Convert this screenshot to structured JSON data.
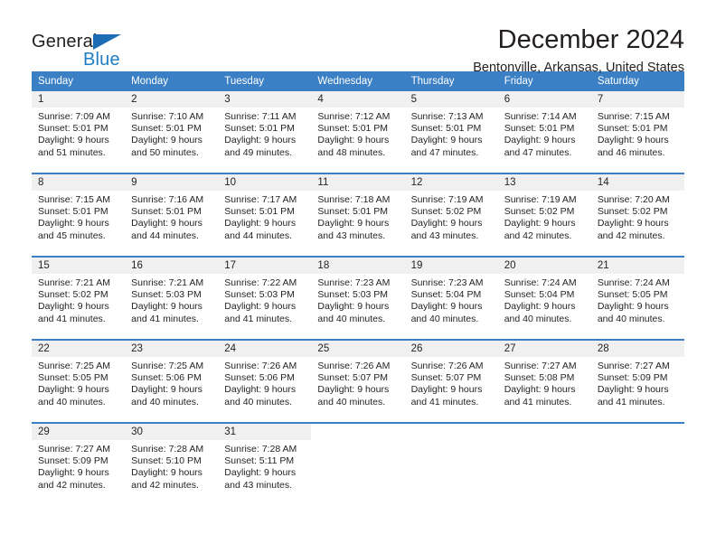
{
  "brand": {
    "name_part1": "General",
    "name_part2": "Blue",
    "triangle_color": "#1b6cb5",
    "blue_color": "#1f7ec4"
  },
  "header": {
    "month_title": "December 2024",
    "location": "Bentonville, Arkansas, United States"
  },
  "theme": {
    "header_bg": "#3b7fc4",
    "daynum_bg": "#f0f0f0",
    "rule_color": "#3b7fc4",
    "text_color": "#231f20"
  },
  "labels": {
    "sunrise_prefix": "Sunrise:",
    "sunset_prefix": "Sunset:",
    "daylight_prefix": "Daylight:"
  },
  "weekday_headers": [
    "Sunday",
    "Monday",
    "Tuesday",
    "Wednesday",
    "Thursday",
    "Friday",
    "Saturday"
  ],
  "weeks": [
    [
      {
        "day": "1",
        "sunrise": "Sunrise: 7:09 AM",
        "sunset": "Sunset: 5:01 PM",
        "daylight": "Daylight: 9 hours and 51 minutes."
      },
      {
        "day": "2",
        "sunrise": "Sunrise: 7:10 AM",
        "sunset": "Sunset: 5:01 PM",
        "daylight": "Daylight: 9 hours and 50 minutes."
      },
      {
        "day": "3",
        "sunrise": "Sunrise: 7:11 AM",
        "sunset": "Sunset: 5:01 PM",
        "daylight": "Daylight: 9 hours and 49 minutes."
      },
      {
        "day": "4",
        "sunrise": "Sunrise: 7:12 AM",
        "sunset": "Sunset: 5:01 PM",
        "daylight": "Daylight: 9 hours and 48 minutes."
      },
      {
        "day": "5",
        "sunrise": "Sunrise: 7:13 AM",
        "sunset": "Sunset: 5:01 PM",
        "daylight": "Daylight: 9 hours and 47 minutes."
      },
      {
        "day": "6",
        "sunrise": "Sunrise: 7:14 AM",
        "sunset": "Sunset: 5:01 PM",
        "daylight": "Daylight: 9 hours and 47 minutes."
      },
      {
        "day": "7",
        "sunrise": "Sunrise: 7:15 AM",
        "sunset": "Sunset: 5:01 PM",
        "daylight": "Daylight: 9 hours and 46 minutes."
      }
    ],
    [
      {
        "day": "8",
        "sunrise": "Sunrise: 7:15 AM",
        "sunset": "Sunset: 5:01 PM",
        "daylight": "Daylight: 9 hours and 45 minutes."
      },
      {
        "day": "9",
        "sunrise": "Sunrise: 7:16 AM",
        "sunset": "Sunset: 5:01 PM",
        "daylight": "Daylight: 9 hours and 44 minutes."
      },
      {
        "day": "10",
        "sunrise": "Sunrise: 7:17 AM",
        "sunset": "Sunset: 5:01 PM",
        "daylight": "Daylight: 9 hours and 44 minutes."
      },
      {
        "day": "11",
        "sunrise": "Sunrise: 7:18 AM",
        "sunset": "Sunset: 5:01 PM",
        "daylight": "Daylight: 9 hours and 43 minutes."
      },
      {
        "day": "12",
        "sunrise": "Sunrise: 7:19 AM",
        "sunset": "Sunset: 5:02 PM",
        "daylight": "Daylight: 9 hours and 43 minutes."
      },
      {
        "day": "13",
        "sunrise": "Sunrise: 7:19 AM",
        "sunset": "Sunset: 5:02 PM",
        "daylight": "Daylight: 9 hours and 42 minutes."
      },
      {
        "day": "14",
        "sunrise": "Sunrise: 7:20 AM",
        "sunset": "Sunset: 5:02 PM",
        "daylight": "Daylight: 9 hours and 42 minutes."
      }
    ],
    [
      {
        "day": "15",
        "sunrise": "Sunrise: 7:21 AM",
        "sunset": "Sunset: 5:02 PM",
        "daylight": "Daylight: 9 hours and 41 minutes."
      },
      {
        "day": "16",
        "sunrise": "Sunrise: 7:21 AM",
        "sunset": "Sunset: 5:03 PM",
        "daylight": "Daylight: 9 hours and 41 minutes."
      },
      {
        "day": "17",
        "sunrise": "Sunrise: 7:22 AM",
        "sunset": "Sunset: 5:03 PM",
        "daylight": "Daylight: 9 hours and 41 minutes."
      },
      {
        "day": "18",
        "sunrise": "Sunrise: 7:23 AM",
        "sunset": "Sunset: 5:03 PM",
        "daylight": "Daylight: 9 hours and 40 minutes."
      },
      {
        "day": "19",
        "sunrise": "Sunrise: 7:23 AM",
        "sunset": "Sunset: 5:04 PM",
        "daylight": "Daylight: 9 hours and 40 minutes."
      },
      {
        "day": "20",
        "sunrise": "Sunrise: 7:24 AM",
        "sunset": "Sunset: 5:04 PM",
        "daylight": "Daylight: 9 hours and 40 minutes."
      },
      {
        "day": "21",
        "sunrise": "Sunrise: 7:24 AM",
        "sunset": "Sunset: 5:05 PM",
        "daylight": "Daylight: 9 hours and 40 minutes."
      }
    ],
    [
      {
        "day": "22",
        "sunrise": "Sunrise: 7:25 AM",
        "sunset": "Sunset: 5:05 PM",
        "daylight": "Daylight: 9 hours and 40 minutes."
      },
      {
        "day": "23",
        "sunrise": "Sunrise: 7:25 AM",
        "sunset": "Sunset: 5:06 PM",
        "daylight": "Daylight: 9 hours and 40 minutes."
      },
      {
        "day": "24",
        "sunrise": "Sunrise: 7:26 AM",
        "sunset": "Sunset: 5:06 PM",
        "daylight": "Daylight: 9 hours and 40 minutes."
      },
      {
        "day": "25",
        "sunrise": "Sunrise: 7:26 AM",
        "sunset": "Sunset: 5:07 PM",
        "daylight": "Daylight: 9 hours and 40 minutes."
      },
      {
        "day": "26",
        "sunrise": "Sunrise: 7:26 AM",
        "sunset": "Sunset: 5:07 PM",
        "daylight": "Daylight: 9 hours and 41 minutes."
      },
      {
        "day": "27",
        "sunrise": "Sunrise: 7:27 AM",
        "sunset": "Sunset: 5:08 PM",
        "daylight": "Daylight: 9 hours and 41 minutes."
      },
      {
        "day": "28",
        "sunrise": "Sunrise: 7:27 AM",
        "sunset": "Sunset: 5:09 PM",
        "daylight": "Daylight: 9 hours and 41 minutes."
      }
    ],
    [
      {
        "day": "29",
        "sunrise": "Sunrise: 7:27 AM",
        "sunset": "Sunset: 5:09 PM",
        "daylight": "Daylight: 9 hours and 42 minutes."
      },
      {
        "day": "30",
        "sunrise": "Sunrise: 7:28 AM",
        "sunset": "Sunset: 5:10 PM",
        "daylight": "Daylight: 9 hours and 42 minutes."
      },
      {
        "day": "31",
        "sunrise": "Sunrise: 7:28 AM",
        "sunset": "Sunset: 5:11 PM",
        "daylight": "Daylight: 9 hours and 43 minutes."
      },
      {
        "day": "",
        "sunrise": "",
        "sunset": "",
        "daylight": ""
      },
      {
        "day": "",
        "sunrise": "",
        "sunset": "",
        "daylight": ""
      },
      {
        "day": "",
        "sunrise": "",
        "sunset": "",
        "daylight": ""
      },
      {
        "day": "",
        "sunrise": "",
        "sunset": "",
        "daylight": ""
      }
    ]
  ]
}
